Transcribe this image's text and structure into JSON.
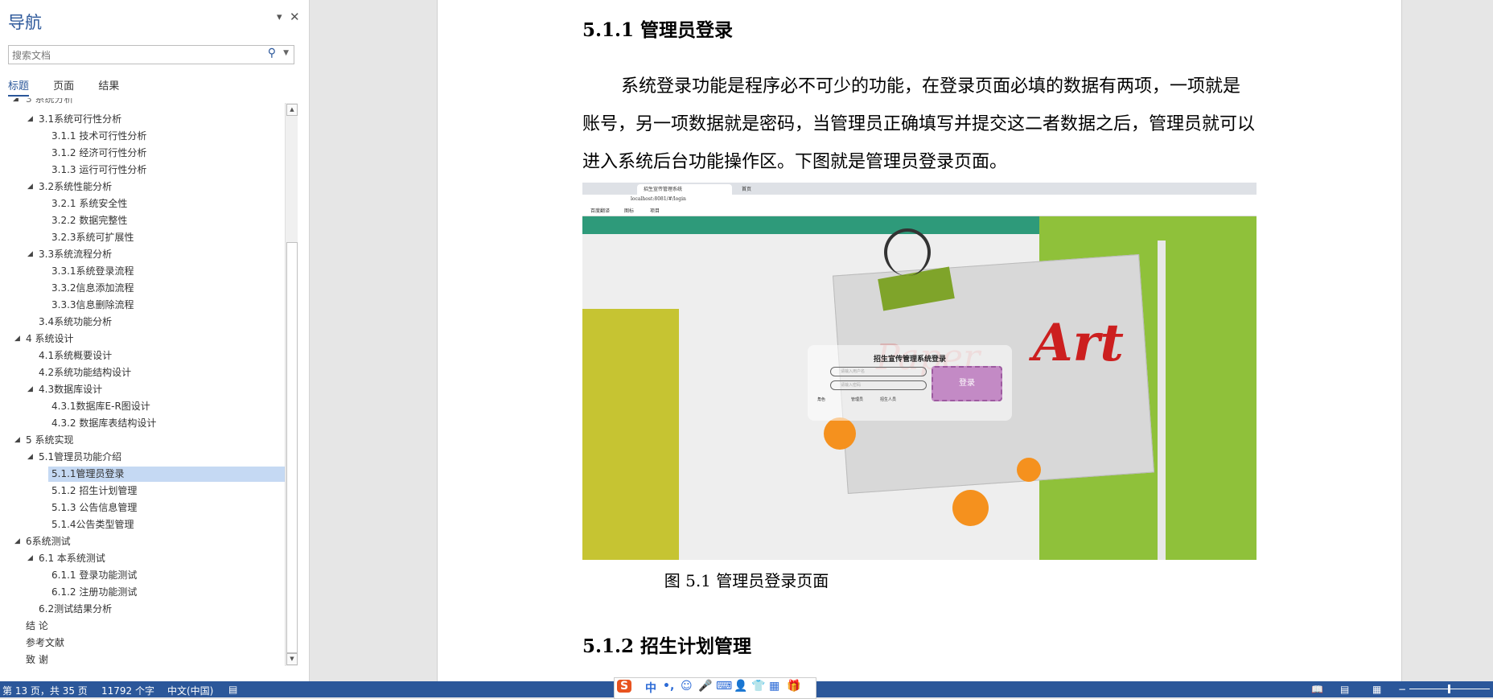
{
  "nav": {
    "title": "导航",
    "close": "✕",
    "collapse": "▾",
    "search_placeholder": "搜索文档",
    "tabs": [
      "标题",
      "页面",
      "结果"
    ],
    "items": [
      "3.1系统可行性分析",
      "3.1.1 技术可行性分析",
      "3.1.2 经济可行性分析",
      "3.1.3 运行可行性分析",
      "3.2系统性能分析",
      "3.2.1 系统安全性",
      "3.2.2 数据完整性",
      "3.2.3系统可扩展性",
      "3.3系统流程分析",
      "3.3.1系统登录流程",
      "3.3.2信息添加流程",
      "3.3.3信息删除流程",
      "3.4系统功能分析",
      "4 系统设计",
      "4.1系统概要设计",
      "4.2系统功能结构设计",
      "4.3数据库设计",
      "4.3.1数据库E-R图设计",
      "4.3.2 数据库表结构设计",
      "5 系统实现",
      "5.1管理员功能介绍",
      "5.1.1管理员登录",
      "5.1.2 招生计划管理",
      "5.1.3 公告信息管理",
      "5.1.4公告类型管理",
      "6系统测试",
      "6.1 本系统测试",
      "6.1.1 登录功能测试",
      "6.1.2 注册功能测试",
      "6.2测试结果分析",
      "结 论",
      "参考文献",
      "致 谢"
    ]
  },
  "doc": {
    "heading1": "5.1.1 管理员登录",
    "paragraph": "系统登录功能是程序必不可少的功能，在登录页面必填的数据有两项，一项就是账号，另一项数据就是密码，当管理员正确填写并提交这二者数据之后，管理员就可以进入系统后台功能操作区。下图就是管理员登录页面。",
    "caption": "图 5.1  管理员登录页面",
    "heading2": "5.1.2  招生计划管理"
  },
  "figure": {
    "tab1": "招生宣传管理系统",
    "tab2": "首页",
    "url": "localhost:8081/#/login",
    "bookmarks": [
      "百度翻译",
      "图标",
      "项目"
    ],
    "login_title": "招生宣传管理系统登录",
    "user_placeholder": "请输入用户名",
    "pass_placeholder": "请输入密码",
    "login_button": "登录",
    "role_label": "角色",
    "role_options": [
      "管理员",
      "招生人员"
    ],
    "art_text": "Art",
    "paper_text": "Paper"
  },
  "status": {
    "page": "第 13 页，共 35 页",
    "words": "11792 个字",
    "lang": "中文(中国)"
  },
  "ime": {
    "items": [
      "S",
      "中",
      "•,",
      "☺",
      "🎤",
      "⌨",
      "👤",
      "👕",
      "▦",
      "🎁"
    ]
  }
}
